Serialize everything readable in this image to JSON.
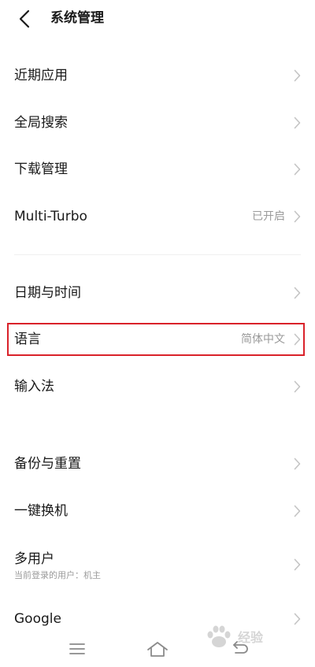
{
  "header": {
    "title": "系统管理",
    "back_icon": "chevron-left-icon"
  },
  "items": [
    {
      "label": "近期应用",
      "value": ""
    },
    {
      "label": "全局搜索",
      "value": ""
    },
    {
      "label": "下载管理",
      "value": ""
    },
    {
      "label": "Multi-Turbo",
      "value": "已开启"
    },
    {
      "label": "日期与时间",
      "value": ""
    },
    {
      "label": "语言",
      "value": "简体中文"
    },
    {
      "label": "输入法",
      "value": ""
    },
    {
      "label": "备份与重置",
      "value": ""
    },
    {
      "label": "一键换机",
      "value": ""
    },
    {
      "label": "多用户",
      "value": "",
      "subtitle": "当前登录的用户：机主"
    },
    {
      "label": "Google",
      "value": ""
    }
  ],
  "highlight": {
    "target": "语言",
    "color": "#d9222a"
  },
  "navbar": {
    "buttons": [
      "menu-icon",
      "home-icon",
      "back-icon"
    ]
  },
  "watermark": {
    "text": "经验"
  },
  "colors": {
    "text": "#1a1a1a",
    "secondary": "#9a9a9a",
    "chevron": "#c4c4c4",
    "divider": "#f0f0f0"
  }
}
